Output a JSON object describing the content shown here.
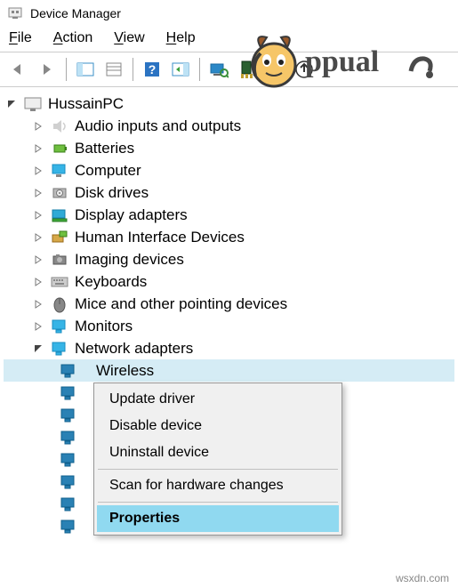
{
  "title": "Device Manager",
  "menus": {
    "file": "File",
    "action": "Action",
    "view": "View",
    "help": "Help"
  },
  "root": "HussainPC",
  "categories": [
    {
      "label": "Audio inputs and outputs",
      "icon": "speaker"
    },
    {
      "label": "Batteries",
      "icon": "battery"
    },
    {
      "label": "Computer",
      "icon": "computer"
    },
    {
      "label": "Disk drives",
      "icon": "disk"
    },
    {
      "label": "Display adapters",
      "icon": "display"
    },
    {
      "label": "Human Interface Devices",
      "icon": "hid"
    },
    {
      "label": "Imaging devices",
      "icon": "imaging"
    },
    {
      "label": "Keyboards",
      "icon": "keyboard"
    },
    {
      "label": "Mice and other pointing devices",
      "icon": "mouse"
    },
    {
      "label": "Monitors",
      "icon": "monitor"
    },
    {
      "label": "Network adapters",
      "icon": "network",
      "expanded": true
    }
  ],
  "network_selected": "Wireless",
  "context_menu": {
    "update": "Update driver",
    "disable": "Disable device",
    "uninstall": "Uninstall device",
    "scan": "Scan for hardware changes",
    "properties": "Properties"
  },
  "watermark_text": "Appuals",
  "footer": "wsxdn.com"
}
